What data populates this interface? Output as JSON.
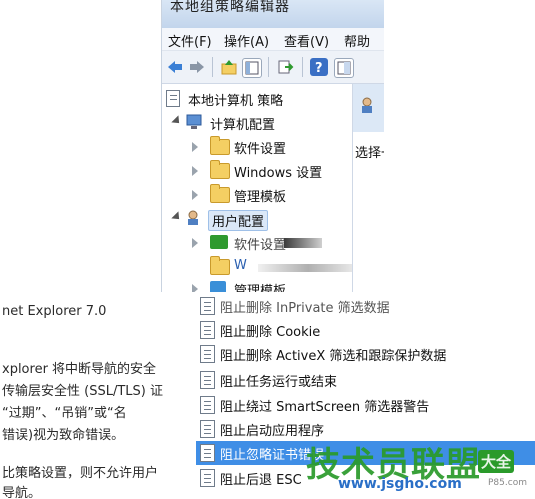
{
  "window": {
    "title": "本地组策略编辑器",
    "menu": [
      "文件(F)",
      "操作(A)",
      "查看(V)",
      "帮助"
    ]
  },
  "tree": {
    "root": "本地计算机 策略",
    "computer_config": "计算机配置",
    "software_settings": "软件设置",
    "windows_settings": "Windows 设置",
    "admin_templates": "管理模板",
    "user_config": "用户配置",
    "user_software_settings": "软件设置",
    "user_windows_partial": "W",
    "user_admin_partial": "管理模板"
  },
  "right_pane": {
    "select_text": "选择一"
  },
  "left_text": {
    "lines": [
      "net Explorer 7.0",
      "",
      "xplorer 将中断导航的安全",
      "传输层安全性 (SSL/TLS) 证",
      "“过期”、“吊销”或“名",
      "错误)视为致命错误。",
      "",
      "比策略设置，则不允许用户",
      "导航。"
    ]
  },
  "policy_list": {
    "items": [
      {
        "label": "阻止删除 InPrivate 筛选数据",
        "highlighted": false
      },
      {
        "label": "阻止删除 Cookie",
        "highlighted": false
      },
      {
        "label": "阻止删除 ActiveX 筛选和跟踪保护数据",
        "highlighted": false
      },
      {
        "label": "阻止任务运行或结束",
        "highlighted": false
      },
      {
        "label": "阻止绕过 SmartScreen 筛选器警告",
        "highlighted": false
      },
      {
        "label": "阻止启动应用程序",
        "highlighted": false
      },
      {
        "label": "阻止忽略证书错误",
        "highlighted": true
      },
      {
        "label": "阻止后退 ESC",
        "highlighted": false
      }
    ]
  },
  "watermark": {
    "brand": "技术员联盟",
    "badge": "大全",
    "url": "www.jsgho.com",
    "tail": "P85.com"
  },
  "colors": {
    "selection": "#3f8ee6",
    "watermark_green": "#2a9a2a",
    "folder": "#f4cf63"
  }
}
